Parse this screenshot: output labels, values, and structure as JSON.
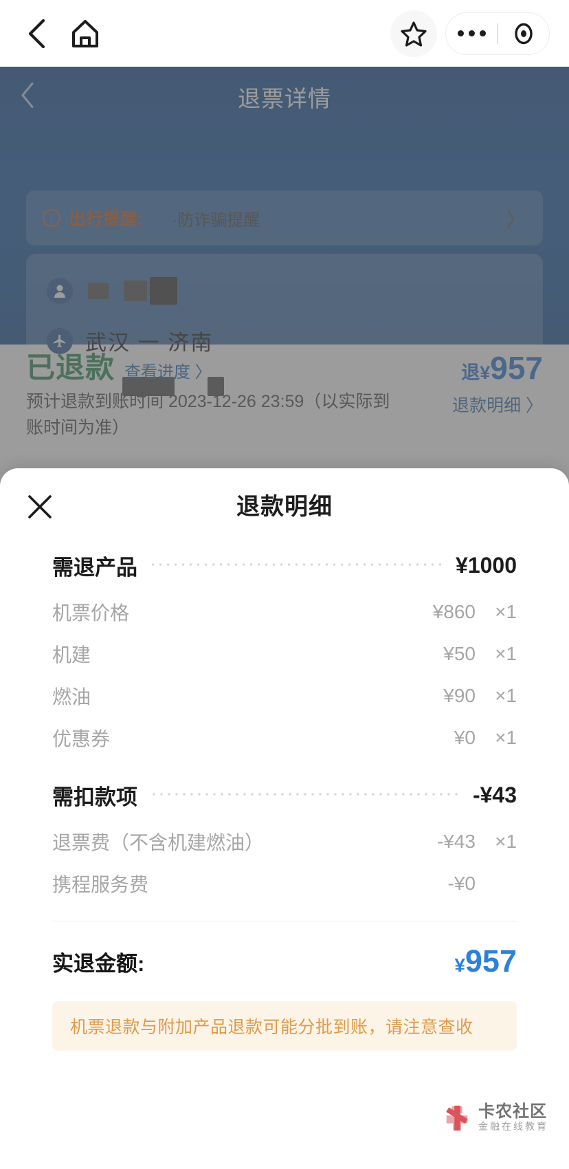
{
  "browser": {
    "back_icon": "chevron-left-icon",
    "home_icon": "home-icon",
    "star_icon": "star-icon",
    "more_icon": "more-dots-icon",
    "target_icon": "target-circle-icon"
  },
  "app": {
    "nav": {
      "back_icon": "chevron-left-icon",
      "title": "退票详情"
    },
    "notice": {
      "info_icon": "info-circle-icon",
      "label": "出行提醒:",
      "text": "·防诈骗提醒",
      "arrow_icon": "chevron-right-icon"
    },
    "flight": {
      "passenger_icon": "passenger-icon",
      "plane_icon": "airplane-icon",
      "route": "武汉 一 济南"
    },
    "status": {
      "state": "已退款",
      "progress_link": "查看进度 〉",
      "amount_prefix": "退¥",
      "amount": "957",
      "eta": "预计退款到账时间 2023-12-26 23:59（以实际到账时间为准）",
      "detail_link": "退款明细 〉"
    }
  },
  "modal": {
    "close_icon": "close-x-icon",
    "title": "退款明细",
    "groups": [
      {
        "label": "需退产品",
        "value": "¥1000",
        "items": [
          {
            "name": "机票价格",
            "price": "¥860",
            "qty": "×1"
          },
          {
            "name": "机建",
            "price": "¥50",
            "qty": "×1"
          },
          {
            "name": "燃油",
            "price": "¥90",
            "qty": "×1"
          },
          {
            "name": "优惠券",
            "price": "¥0",
            "qty": "×1"
          }
        ]
      },
      {
        "label": "需扣款项",
        "value": "-¥43",
        "items": [
          {
            "name": "退票费（不含机建燃油）",
            "price": "-¥43",
            "qty": "×1"
          },
          {
            "name": "携程服务费",
            "price": "-¥0",
            "qty": ""
          }
        ]
      }
    ],
    "total": {
      "label": "实退金额:",
      "currency": "¥",
      "amount": "957"
    },
    "tip": "机票退款与附加产品退款可能分批到账，请注意查收"
  },
  "watermark": {
    "name": "卡农社区",
    "tagline": "金融在线教育",
    "logo_icon": "flower-logo-icon"
  },
  "colors": {
    "brand_blue": "#1d5ba4",
    "accent_blue": "#2a78d4",
    "success_green": "#2e8b57",
    "warning_orange": "#e09a49",
    "notice_orange": "#c4601f"
  }
}
